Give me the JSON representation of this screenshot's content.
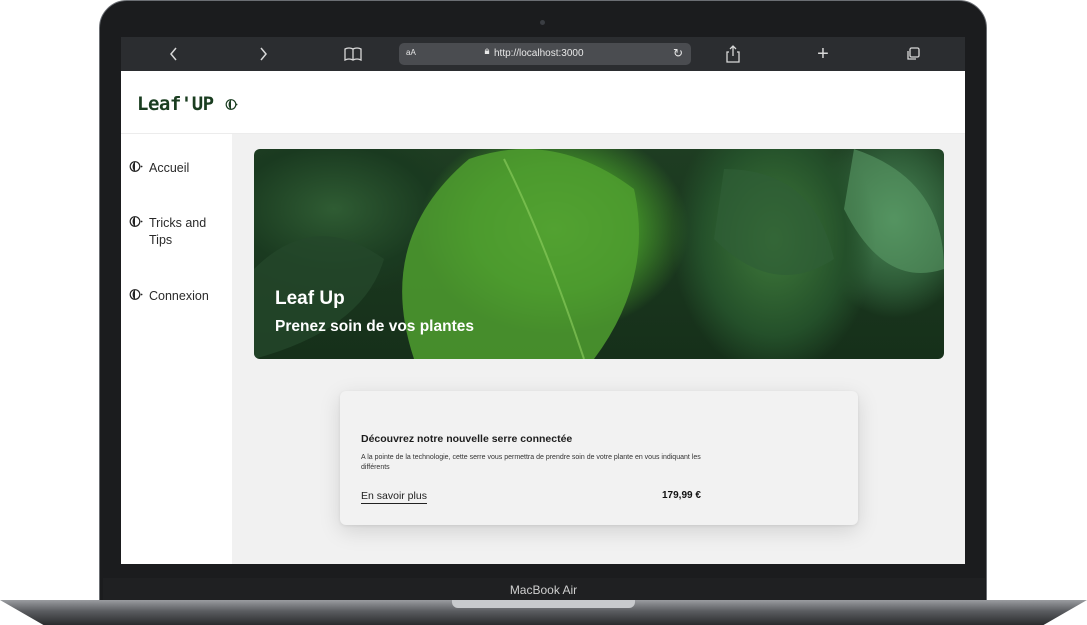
{
  "device": {
    "model_label": "MacBook Air"
  },
  "browser": {
    "back_icon": "chevron-left-icon",
    "forward_icon": "chevron-right-icon",
    "bookmarks_icon": "book-icon",
    "reader_label": "aA",
    "url": "http://localhost:3000",
    "reload_icon": "reload-icon",
    "share_icon": "share-icon",
    "new_tab_label": "+",
    "tabs_icon": "tabs-icon"
  },
  "app": {
    "logo": "Leaf'UP"
  },
  "sidebar": {
    "items": [
      {
        "label": "Accueil"
      },
      {
        "label": "Tricks and Tips"
      },
      {
        "label": "Connexion"
      }
    ]
  },
  "hero": {
    "title": "Leaf Up",
    "subtitle": "Prenez soin de vos plantes"
  },
  "product_card": {
    "title": "Découvrez notre nouvelle serre connectée",
    "description": "A la pointe de la technologie, cette serre vous permettra de prendre soin de votre plante en vous indiquant les différents",
    "link_label": "En savoir plus",
    "price": "179,99 €"
  },
  "colors": {
    "logo": "#1a3d20",
    "toolbar": "#2b2d30",
    "page_background": "#f1f1f1"
  }
}
